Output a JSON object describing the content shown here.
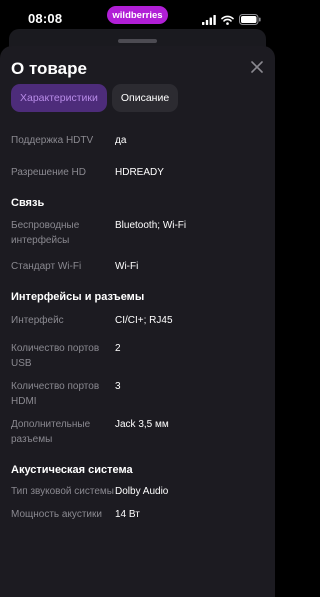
{
  "status_bar": {
    "time": "08:08",
    "site": "wildberries"
  },
  "sheet": {
    "title": "О товаре",
    "tabs": [
      {
        "label": "Характеристики"
      },
      {
        "label": "Описание"
      }
    ],
    "groups": [
      {
        "rows": [
          {
            "key": "Поддержка HDTV",
            "value": "да"
          },
          {
            "key": "Разрешение HD",
            "value": "HDREADY"
          }
        ]
      },
      {
        "title": "Связь",
        "rows": [
          {
            "key": "Беспроводные интерфейсы",
            "value": "Bluetooth; Wi-Fi"
          },
          {
            "key": "Стандарт Wi-Fi",
            "value": "Wi-Fi"
          }
        ]
      },
      {
        "title": "Интерфейсы и разъемы",
        "rows": [
          {
            "key": "Интерфейс",
            "value": "CI/CI+; RJ45"
          },
          {
            "key": "Количество портов USB",
            "value": "2"
          },
          {
            "key": "Количество портов HDMI",
            "value": "3"
          },
          {
            "key": "Дополнительные разъемы",
            "value": "Jack 3,5 мм"
          }
        ]
      },
      {
        "title": "Акустическая система",
        "rows": [
          {
            "key": "Тип звуковой системы",
            "value": "Dolby Audio"
          },
          {
            "key": "Мощность акустики",
            "value": "14 Вт"
          }
        ]
      }
    ]
  },
  "colors": {
    "sheet_bg": "#1c1b21",
    "tab_active_bg": "#4d2c7a",
    "tab_active_text": "#b88be8",
    "tab_inactive_bg": "#2c2b31",
    "brand": "#b11fd6",
    "muted_text": "#8a8990"
  },
  "icons": [
    "signal-icon",
    "wifi-icon",
    "battery-icon",
    "close-icon"
  ]
}
